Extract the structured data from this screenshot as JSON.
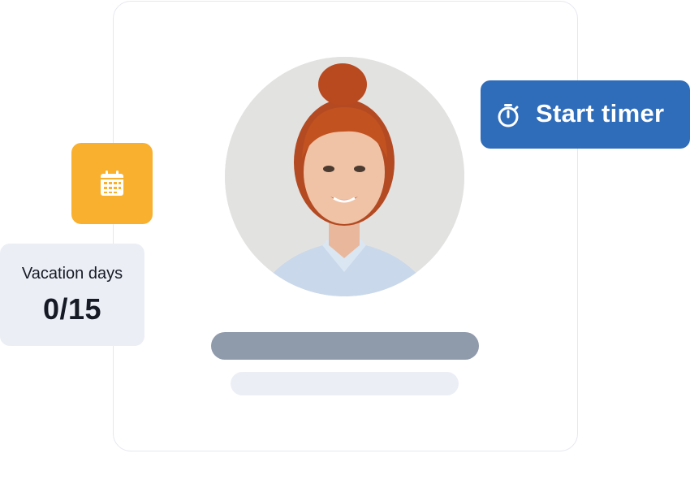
{
  "timer": {
    "label": "Start timer",
    "icon": "stopwatch-icon",
    "background": "#2f6cba"
  },
  "calendar_tile": {
    "icon": "calendar-icon",
    "background": "#f9b02f"
  },
  "vacation": {
    "label": "Vacation days",
    "value": "0/15"
  },
  "profile": {
    "avatar": "avatar",
    "name_placeholder_color": "#8f9aab",
    "subtitle_placeholder_color": "#eceef6"
  }
}
